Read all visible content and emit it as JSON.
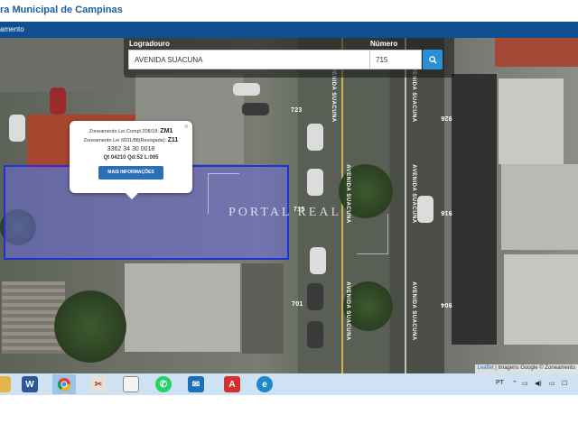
{
  "header": {
    "title": "ra Municipal de Campinas"
  },
  "navbar": {
    "item": "amento"
  },
  "search": {
    "logradouro_label": "Logradouro",
    "logradouro_value": "AVENIDA SUACUNA",
    "numero_label": "Número",
    "numero_value": "715",
    "search_icon": "search-icon"
  },
  "popup": {
    "line1_prefix": "Zoneamento Lei Compl 208/18:",
    "line1_zone": "ZM1",
    "line2_prefix": "Zoneamento Lei 6031/88(Revogada):",
    "line2_zone": "Z11",
    "code": "3362 34 30 0018",
    "lot": "Qt 04210 Qd:52 L:005",
    "button": "MAIS INFORMAÇÕES",
    "close": "×"
  },
  "map": {
    "numbers": [
      "723",
      "715",
      "701",
      "926",
      "916",
      "904"
    ],
    "streets": [
      "AVENIDA SUACUNA",
      "AVENIDA SUACUNA",
      "AVENIDA SUACUNA"
    ],
    "watermark": "PORTAL REAL",
    "attribution_leaflet": "Leaflet",
    "attribution_rest": "| Imagens Google © Zoneamento"
  },
  "taskbar": {
    "lang": "PT",
    "icons": [
      "folder-icon",
      "word-icon",
      "chrome-icon",
      "app-icon",
      "calculator-icon",
      "whatsapp-icon",
      "mail-icon",
      "pdf-icon",
      "edge-icon"
    ],
    "tray_icons": [
      "chevron-up-icon",
      "network-icon",
      "volume-icon",
      "battery-icon"
    ]
  }
}
